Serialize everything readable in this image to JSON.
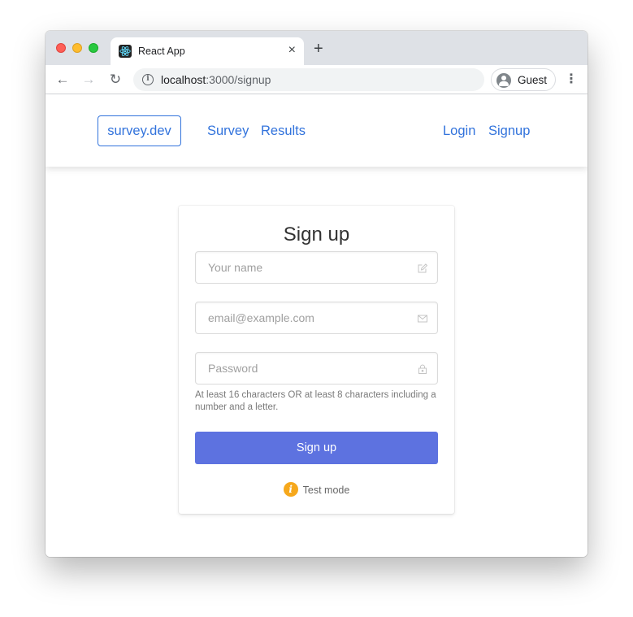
{
  "browser": {
    "tab_title": "React App",
    "tab_close": "×",
    "new_tab": "+",
    "url_host": "localhost",
    "url_rest": ":3000/signup",
    "profile_label": "Guest",
    "back": "←",
    "forward": "→",
    "reload": "↻",
    "menu": "⋮"
  },
  "navbar": {
    "brand": "survey.dev",
    "links": [
      "Survey",
      "Results"
    ],
    "auth_links": [
      "Login",
      "Signup"
    ]
  },
  "signup": {
    "title": "Sign up",
    "name_placeholder": "Your name",
    "email_placeholder": "email@example.com",
    "password_placeholder": "Password",
    "password_help": "At least 16 characters OR at least 8 characters including a number and a letter.",
    "submit_label": "Sign up",
    "test_mode_label": "Test mode",
    "test_mode_icon": "i"
  },
  "colors": {
    "link": "#3273dc",
    "submit": "#5d72e0",
    "test_mode_icon": "#f6a81c"
  },
  "icons": [
    "react-favicon",
    "info-icon",
    "guest-avatar-icon",
    "edit-icon",
    "envelope-icon",
    "lock-icon",
    "info-circle-icon"
  ]
}
